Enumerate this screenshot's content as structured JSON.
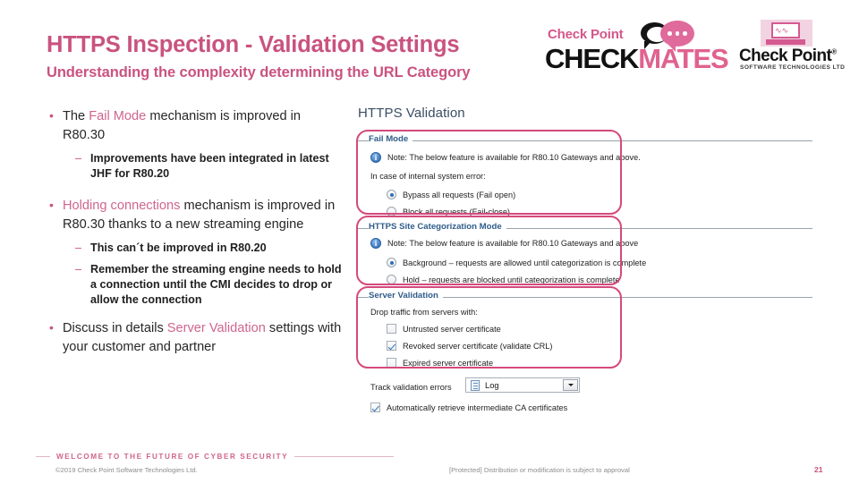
{
  "header": {
    "title": "HTTPS Inspection -  Validation Settings",
    "subtitle": "Understanding the complexity determining the URL Category"
  },
  "checkmates_logo": {
    "top_text": "Check Point",
    "main_text_dark": "CHECK",
    "main_text_pink": "MATES"
  },
  "checkpoint_logo": {
    "name": "Check Point",
    "registered": "®",
    "tagline": "SOFTWARE TECHNOLOGIES LTD"
  },
  "bullets": [
    {
      "level": 1,
      "segments": [
        {
          "text": "The ",
          "highlight": false
        },
        {
          "text": "Fail Mode",
          "highlight": true
        },
        {
          "text": " mechanism is improved in R80.30",
          "highlight": false
        }
      ]
    },
    {
      "level": 2,
      "segments": [
        {
          "text": "Improvements have been integrated in latest JHF for R80.20",
          "highlight": false
        }
      ]
    },
    {
      "level": 1,
      "segments": [
        {
          "text": "Holding connections",
          "highlight": true
        },
        {
          "text": " mechanism is improved in R80.30 thanks to a new streaming engine",
          "highlight": false
        }
      ]
    },
    {
      "level": 2,
      "segments": [
        {
          "text": "This can´t be improved in R80.20",
          "highlight": false
        }
      ]
    },
    {
      "level": 2,
      "segments": [
        {
          "text": "Remember the streaming engine needs to hold a connection until the CMI decides to drop or allow the connection",
          "highlight": false
        }
      ]
    },
    {
      "level": 1,
      "segments": [
        {
          "text": "Discuss in details ",
          "highlight": false
        },
        {
          "text": "Server Validation",
          "highlight": true
        },
        {
          "text": " settings with your customer and partner",
          "highlight": false
        }
      ]
    }
  ],
  "dialog": {
    "title": "HTTPS Validation",
    "fail_mode": {
      "legend": "Fail Mode",
      "note": "Note: The below feature is available for R80.10 Gateways and above.",
      "prompt": "In case of internal system error:",
      "options": [
        {
          "label": "Bypass all requests (Fail open)",
          "selected": true
        },
        {
          "label": "Block all requests (Fail-close)",
          "selected": false
        }
      ]
    },
    "categorization_mode": {
      "legend": "HTTPS Site Categorization Mode",
      "note": "Note: The below feature is available for R80.10 Gateways and above",
      "options": [
        {
          "label": "Background – requests are allowed until categorization is complete",
          "selected": true
        },
        {
          "label": "Hold – requests are blocked until categorization is complete",
          "selected": false
        }
      ]
    },
    "server_validation": {
      "legend": "Server Validation",
      "prompt": "Drop traffic from servers with:",
      "options": [
        {
          "label": "Untrusted server certificate",
          "checked": false
        },
        {
          "label": "Revoked server certificate (validate CRL)",
          "checked": true
        },
        {
          "label": "Expired server certificate",
          "checked": false
        }
      ]
    },
    "track": {
      "label": "Track validation errors",
      "value": "Log"
    },
    "auto_retrieve": {
      "label": "Automatically retrieve intermediate CA certificates",
      "checked": true
    }
  },
  "footer": {
    "tagline": "WELCOME TO THE FUTURE OF CYBER SECURITY",
    "copyright": "©2019 Check Point Software Technologies Ltd.",
    "protected": "[Protected] Distribution or modification is subject to approval",
    "page_number": "21"
  },
  "colors": {
    "brand_pink": "#c9537f",
    "accent_pink": "#d0658e",
    "callout_pink": "#d44a7c",
    "dialog_legend_blue": "#2f5c8a"
  }
}
